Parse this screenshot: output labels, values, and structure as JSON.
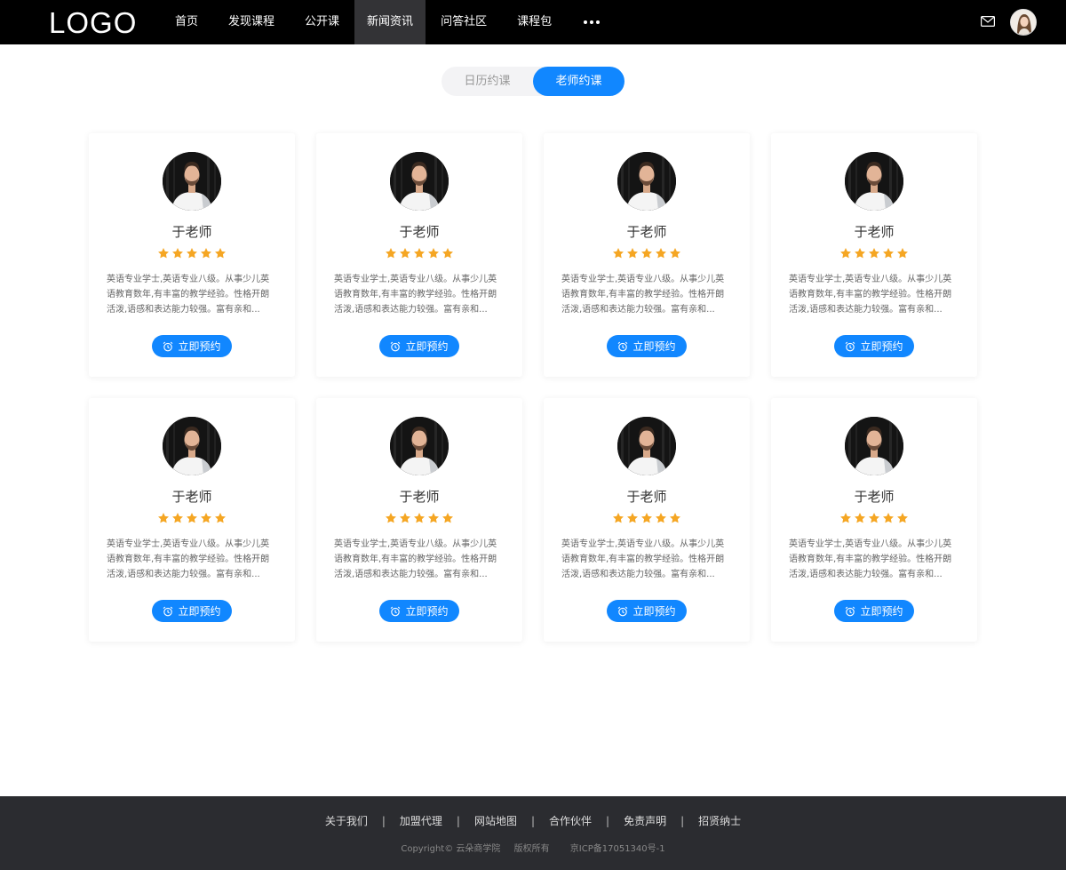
{
  "header": {
    "logo": "LOGO",
    "nav": [
      {
        "label": "首页",
        "active": false
      },
      {
        "label": "发现课程",
        "active": false
      },
      {
        "label": "公开课",
        "active": false
      },
      {
        "label": "新闻资讯",
        "active": true
      },
      {
        "label": "问答社区",
        "active": false
      },
      {
        "label": "课程包",
        "active": false
      }
    ],
    "more_icon": "more-dots-icon",
    "mail_icon": "mail-icon",
    "avatar_icon": "user-avatar"
  },
  "tabs": [
    {
      "label": "日历约课",
      "active": false
    },
    {
      "label": "老师约课",
      "active": true
    }
  ],
  "colors": {
    "accent": "#1187ff",
    "star": "#f5a623",
    "header_bg": "#000000",
    "footer_bg": "#2b2c30"
  },
  "teachers": [
    {
      "name": "于老师",
      "rating": 5,
      "desc": "英语专业学士,英语专业八级。从事少儿英语教育数年,有丰富的教学经验。性格开朗活泼,语感和表达能力较强。富有亲和...",
      "button": "立即预约"
    },
    {
      "name": "于老师",
      "rating": 5,
      "desc": "英语专业学士,英语专业八级。从事少儿英语教育数年,有丰富的教学经验。性格开朗活泼,语感和表达能力较强。富有亲和...",
      "button": "立即预约"
    },
    {
      "name": "于老师",
      "rating": 5,
      "desc": "英语专业学士,英语专业八级。从事少儿英语教育数年,有丰富的教学经验。性格开朗活泼,语感和表达能力较强。富有亲和...",
      "button": "立即预约"
    },
    {
      "name": "于老师",
      "rating": 5,
      "desc": "英语专业学士,英语专业八级。从事少儿英语教育数年,有丰富的教学经验。性格开朗活泼,语感和表达能力较强。富有亲和...",
      "button": "立即预约"
    },
    {
      "name": "于老师",
      "rating": 5,
      "desc": "英语专业学士,英语专业八级。从事少儿英语教育数年,有丰富的教学经验。性格开朗活泼,语感和表达能力较强。富有亲和...",
      "button": "立即预约"
    },
    {
      "name": "于老师",
      "rating": 5,
      "desc": "英语专业学士,英语专业八级。从事少儿英语教育数年,有丰富的教学经验。性格开朗活泼,语感和表达能力较强。富有亲和...",
      "button": "立即预约"
    },
    {
      "name": "于老师",
      "rating": 5,
      "desc": "英语专业学士,英语专业八级。从事少儿英语教育数年,有丰富的教学经验。性格开朗活泼,语感和表达能力较强。富有亲和...",
      "button": "立即预约"
    },
    {
      "name": "于老师",
      "rating": 5,
      "desc": "英语专业学士,英语专业八级。从事少儿英语教育数年,有丰富的教学经验。性格开朗活泼,语感和表达能力较强。富有亲和...",
      "button": "立即预约"
    }
  ],
  "footer": {
    "links": [
      "关于我们",
      "加盟代理",
      "网站地图",
      "合作伙伴",
      "免责声明",
      "招贤纳士"
    ],
    "separator": "|",
    "copyright": "Copyright© 云朵商学院",
    "rights": "版权所有",
    "icp": "京ICP备17051340号-1"
  }
}
